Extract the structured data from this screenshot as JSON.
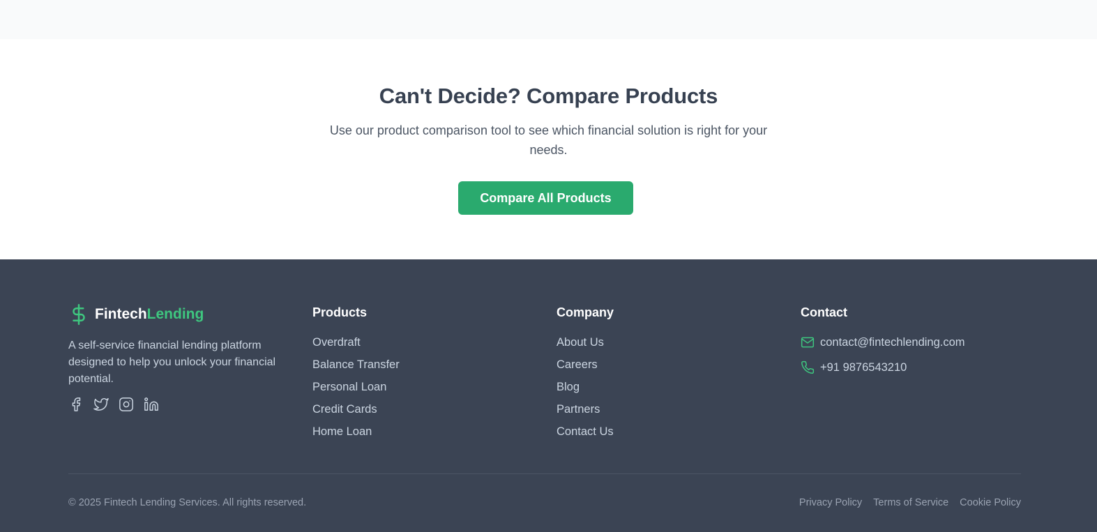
{
  "compare": {
    "title": "Can't Decide? Compare Products",
    "subtitle": "Use our product comparison tool to see which financial solution is right for your needs.",
    "button_label": "Compare All Products"
  },
  "colors": {
    "accent": "#2aaa6e",
    "brand_green": "#3ec67f",
    "footer_bg": "#3b4454",
    "heading": "#374151"
  },
  "footer": {
    "brand": {
      "name_part1": "Fintech",
      "name_part2": "Lending",
      "icon": "dollar-icon"
    },
    "about": "A self-service financial lending platform designed to help you unlock your financial potential.",
    "social": [
      "facebook-icon",
      "twitter-icon",
      "instagram-icon",
      "linkedin-icon"
    ],
    "products": {
      "heading": "Products",
      "items": [
        "Overdraft",
        "Balance Transfer",
        "Personal Loan",
        "Credit Cards",
        "Home Loan"
      ]
    },
    "company": {
      "heading": "Company",
      "items": [
        "About Us",
        "Careers",
        "Blog",
        "Partners",
        "Contact Us"
      ]
    },
    "contact": {
      "heading": "Contact",
      "email": "contact@fintechlending.com",
      "phone": "+91 9876543210"
    },
    "copyright": "© 2025 Fintech Lending Services. All rights reserved.",
    "legal": [
      "Privacy Policy",
      "Terms of Service",
      "Cookie Policy"
    ]
  }
}
